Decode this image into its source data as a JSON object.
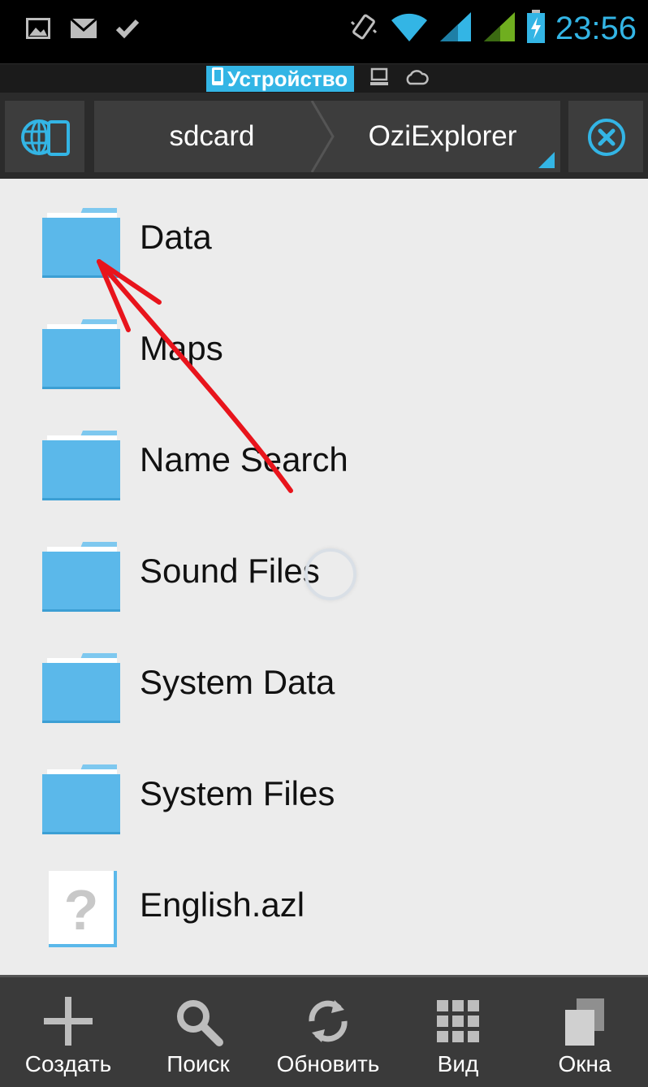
{
  "status_bar": {
    "time": "23:56",
    "left_icons": [
      "gallery-icon",
      "mail-icon",
      "check-icon"
    ],
    "right_icons": [
      "vibrate-icon",
      "wifi-icon",
      "signal-icon",
      "signal-icon",
      "battery-charging-icon"
    ]
  },
  "location_bar": {
    "device_label": "Устройство",
    "icons": [
      "device-icon",
      "computer-icon",
      "cloud-icon"
    ]
  },
  "path_bar": {
    "crumbs": [
      "sdcard",
      "OziExplorer"
    ],
    "left_icon": "globe-device-icon",
    "right_icon": "close-circle-icon"
  },
  "files": [
    {
      "name": "Data",
      "type": "folder"
    },
    {
      "name": "Maps",
      "type": "folder"
    },
    {
      "name": "Name Search",
      "type": "folder"
    },
    {
      "name": "Sound Files",
      "type": "folder"
    },
    {
      "name": "System Data",
      "type": "folder"
    },
    {
      "name": "System Files",
      "type": "folder"
    },
    {
      "name": "English.azl",
      "type": "unknown-file"
    }
  ],
  "toolbar": {
    "create_label": "Создать",
    "search_label": "Поиск",
    "refresh_label": "Обновить",
    "view_label": "Вид",
    "windows_label": "Окна"
  },
  "colors": {
    "accent": "#33b5e5",
    "folder": "#5bb8ea",
    "annotation": "#e8141c"
  }
}
